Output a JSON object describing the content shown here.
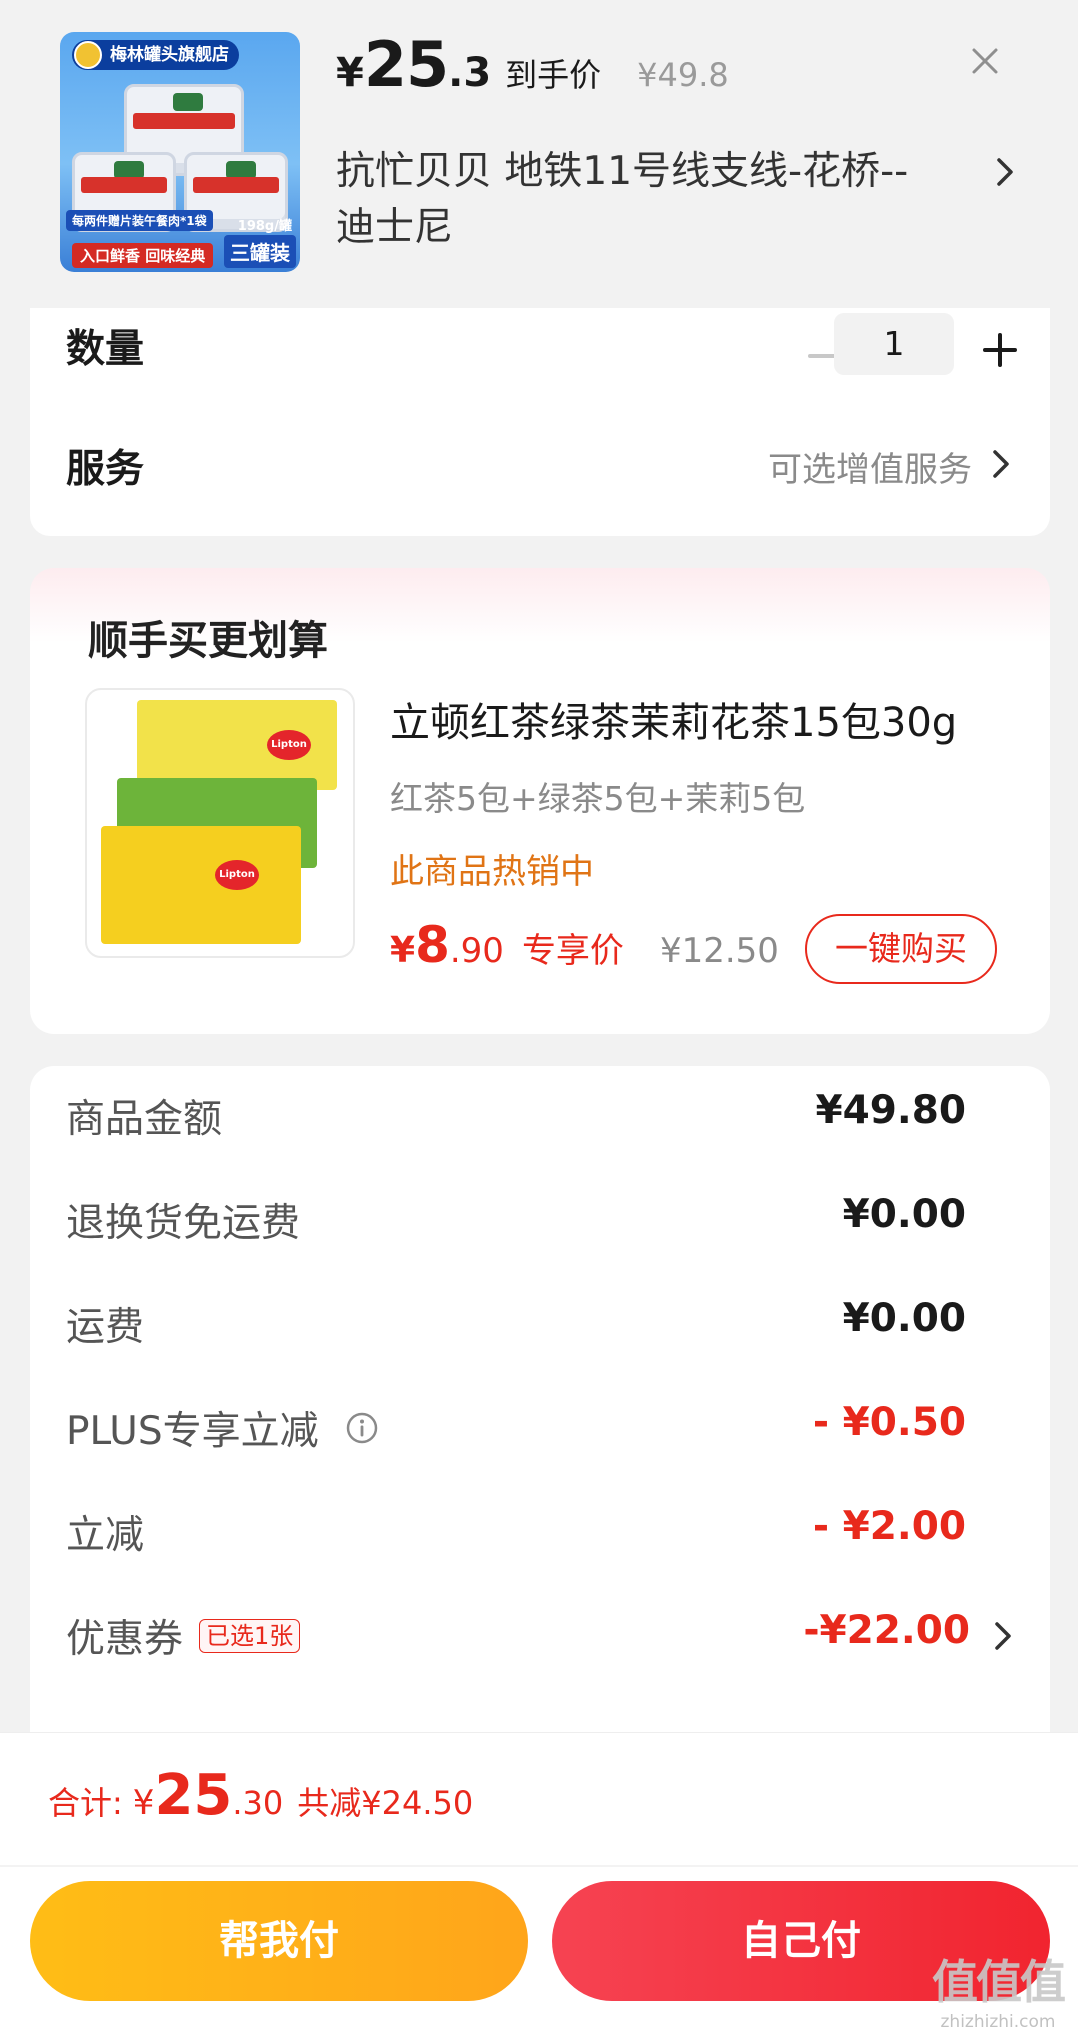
{
  "product": {
    "store_badge": "梅林罐头旗舰店",
    "image_promo": "每两件赠片装午餐肉*1袋",
    "image_slogan": "入口鲜香 回味经典",
    "image_pack": "三罐装",
    "image_weight": "198g/罐",
    "price_currency": "¥",
    "price_int": "25",
    "price_dec": ".3",
    "price_tag": "到手价",
    "original_price": "¥49.8",
    "address": "抗忙贝贝  地铁11号线支线-花桥--迪士尼"
  },
  "quantity": {
    "label": "数量",
    "value": "1"
  },
  "service": {
    "label": "服务",
    "hint": "可选增值服务"
  },
  "upsell": {
    "title": "顺手买更划算",
    "name": "立顿红茶绿茶茉莉花茶15包30g",
    "spec": "红茶5包+绿茶5包+茉莉5包",
    "hot": "此商品热销中",
    "price_currency": "¥",
    "price_int": "8",
    "price_dec": ".90",
    "price_tag": "专享价",
    "original_price": "¥12.50",
    "buy_label": "一键购买",
    "brand_logo": "Lipton"
  },
  "fees": [
    {
      "label": "商品金额",
      "value": "¥49.80",
      "color": "#1a1a1a"
    },
    {
      "label": "退换货免运费",
      "value": "¥0.00",
      "color": "#1a1a1a"
    },
    {
      "label": "运费",
      "value": "¥0.00",
      "color": "#1a1a1a"
    },
    {
      "label": "PLUS专享立减",
      "value": "- ¥0.50",
      "color": "#e8291c",
      "icon": "info-icon"
    },
    {
      "label": "立减",
      "value": "- ¥2.00",
      "color": "#e8291c"
    },
    {
      "label": "优惠券",
      "value": "-¥22.00",
      "color": "#e8291c",
      "tag": "已选1张"
    }
  ],
  "summary": {
    "label": "合计:",
    "currency": "¥",
    "total_int": "25",
    "total_dec": ".30",
    "saved": "共减¥24.50"
  },
  "actions": {
    "help_pay": "帮我付",
    "self_pay": "自己付"
  },
  "watermark": {
    "main": "值值值",
    "sub": "zhizhizhi.com"
  },
  "colors": {
    "accent_red": "#e8291c",
    "hot_orange": "#e07415",
    "help_pay_bg": "#ffb018",
    "self_pay_bg": "#f3303d"
  }
}
